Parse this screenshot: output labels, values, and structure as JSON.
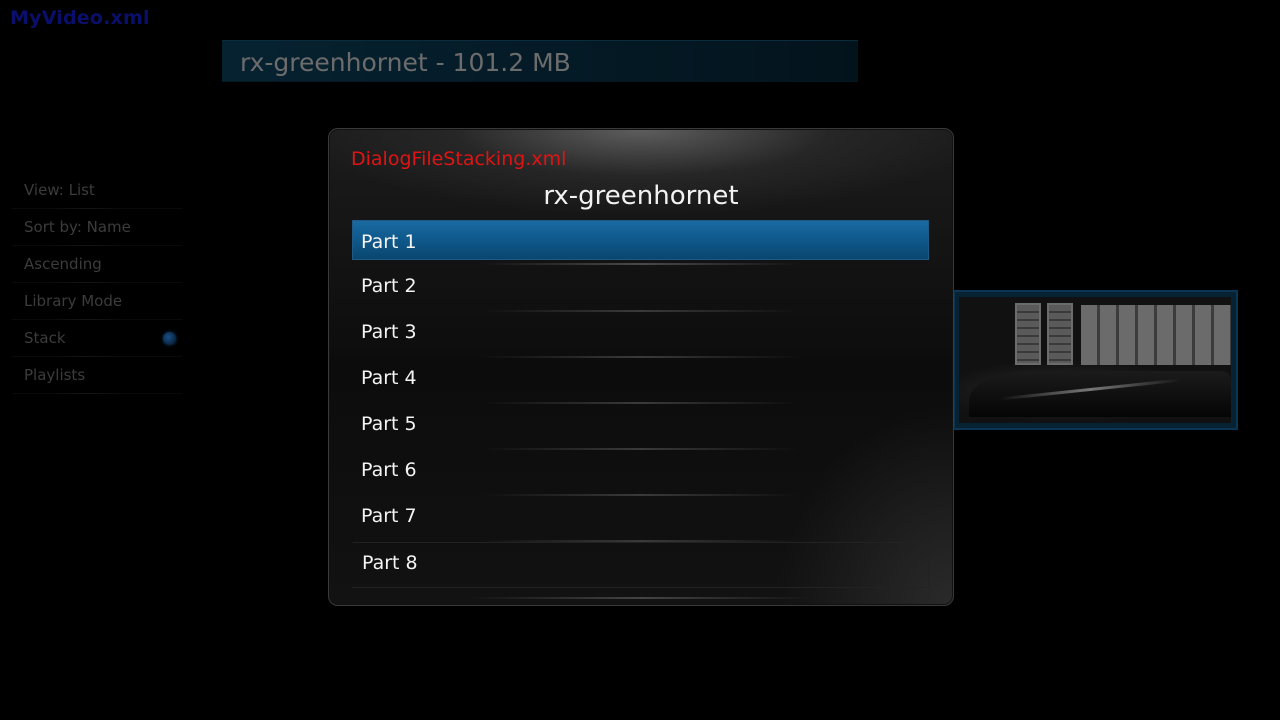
{
  "window": {
    "label": "MyVideo.xml"
  },
  "header": {
    "title": "rx-greenhornet - 101.2 MB"
  },
  "side_menu": {
    "items": [
      {
        "label": "View: List"
      },
      {
        "label": "Sort by: Name"
      },
      {
        "label": "Ascending"
      },
      {
        "label": "Library Mode"
      },
      {
        "label": "Stack",
        "toggle": "on"
      },
      {
        "label": "Playlists"
      }
    ]
  },
  "dialog": {
    "xml_label": "DialogFileStacking.xml",
    "heading": "rx-greenhornet",
    "parts": [
      {
        "label": "Part 1",
        "selected": true
      },
      {
        "label": "Part 2"
      },
      {
        "label": "Part 3"
      },
      {
        "label": "Part 4"
      },
      {
        "label": "Part 5"
      },
      {
        "label": "Part 6"
      },
      {
        "label": "Part 7"
      },
      {
        "label": "Part 8"
      }
    ]
  },
  "colors": {
    "selection": "#0f5a8d",
    "xml_label": "#e01414",
    "window_label": "#0a0f6b"
  }
}
